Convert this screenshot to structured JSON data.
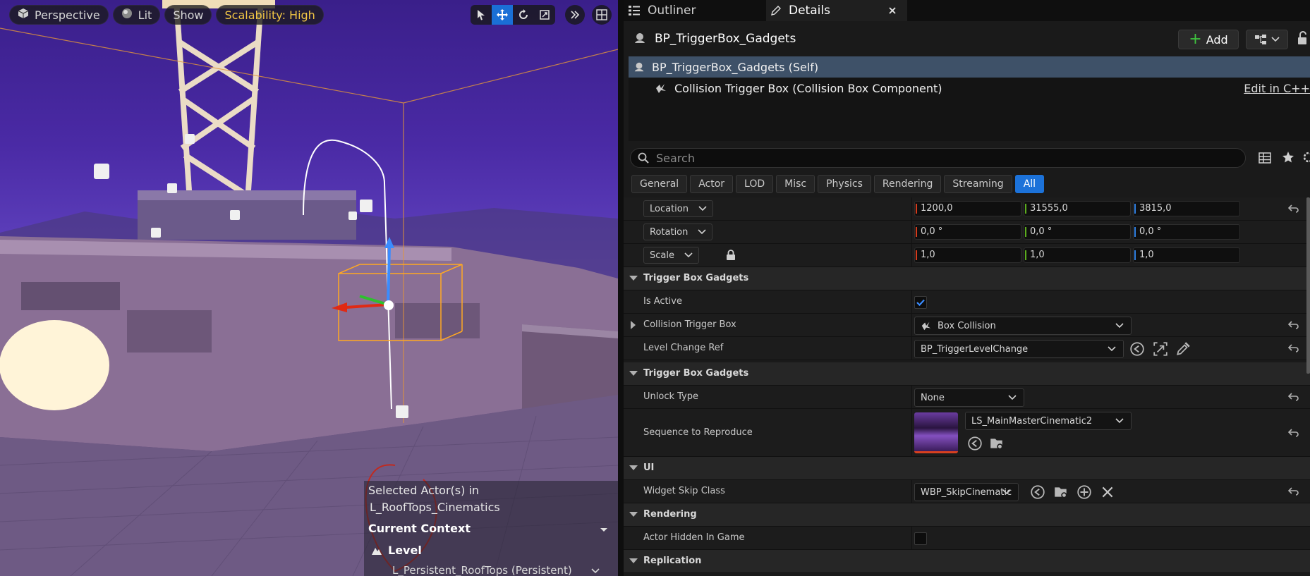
{
  "viewport": {
    "perspective_label": "Perspective",
    "lit_label": "Lit",
    "show_label": "Show",
    "scalability_label": "Scalability: High",
    "context": {
      "selected_actors_line1": "Selected Actor(s) in",
      "selected_actors_line2": "L_RoofTops_Cinematics",
      "current_context_label": "Current Context",
      "level_label": "Level",
      "persistent_level": "L_Persistent_RoofTops (Persistent)"
    }
  },
  "tabs": {
    "outliner": "Outliner",
    "details": "Details"
  },
  "details": {
    "actor_name": "BP_TriggerBox_Gadgets",
    "add_label": "Add",
    "components": [
      {
        "label": "BP_TriggerBox_Gadgets (Self)"
      },
      {
        "label": "Collision Trigger Box (Collision Box Component)"
      }
    ],
    "edit_cpp": "Edit in C++",
    "search_placeholder": "Search",
    "filters": [
      "General",
      "Actor",
      "LOD",
      "Misc",
      "Physics",
      "Rendering",
      "Streaming",
      "All"
    ],
    "transform": {
      "location": {
        "label": "Location",
        "x": "1200,0",
        "y": "31555,0",
        "z": "3815,0"
      },
      "rotation": {
        "label": "Rotation",
        "x": "0,0 °",
        "y": "0,0 °",
        "z": "0,0 °"
      },
      "scale": {
        "label": "Scale",
        "x": "1,0",
        "y": "1,0",
        "z": "1,0"
      }
    },
    "section1": {
      "title": "Trigger Box Gadgets",
      "is_active_label": "Is Active",
      "is_active": true,
      "collision_label": "Collision Trigger Box",
      "collision_value": "Box Collision",
      "level_change_label": "Level Change Ref",
      "level_change_value": "BP_TriggerLevelChange"
    },
    "section2": {
      "title": "Trigger Box Gadgets",
      "unlock_label": "Unlock Type",
      "unlock_value": "None",
      "sequence_label": "Sequence to Reproduce",
      "sequence_value": "LS_MainMasterCinematic2"
    },
    "ui_section": {
      "title": "UI",
      "widget_label": "Widget Skip Class",
      "widget_value": "WBP_SkipCinematic"
    },
    "rendering_section": {
      "title": "Rendering",
      "hidden_label": "Actor Hidden In Game",
      "hidden": false
    },
    "replication_section": {
      "title": "Replication"
    }
  }
}
